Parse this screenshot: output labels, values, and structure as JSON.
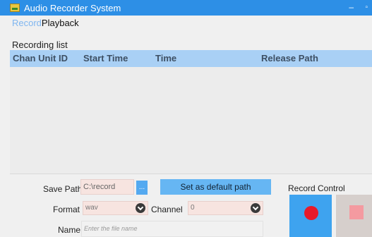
{
  "window": {
    "title": "Audio Recorder System",
    "min_glyph": "–",
    "max_glyph": "▫"
  },
  "tabs": [
    {
      "label": "Record"
    },
    {
      "label": "Playback"
    }
  ],
  "recording_list": {
    "label": "Recording list",
    "columns": [
      "Chan Unit ID",
      "Start Time",
      "Time",
      "Release Path"
    ],
    "rows": []
  },
  "save_path": {
    "label": "Save Path",
    "value": "C:\\record",
    "browse_glyph": "..."
  },
  "default_button": {
    "label": "Set as default path"
  },
  "format": {
    "label": "Format",
    "value": "wav"
  },
  "channel": {
    "label": "Channel",
    "value": "0"
  },
  "name": {
    "label": "Name",
    "placeholder": "Enter the file name"
  },
  "record_control": {
    "label": "Record Control"
  },
  "colors": {
    "accent": "#2d8fe6",
    "record": "#e81a2a",
    "stop": "#f49aa0"
  }
}
